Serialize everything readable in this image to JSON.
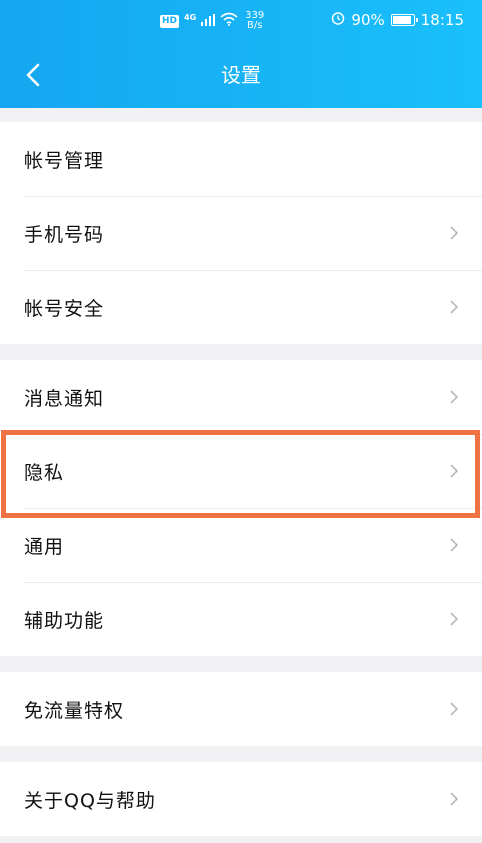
{
  "status_bar": {
    "hd_badge": "HD",
    "network": "4G",
    "speed_value": "339",
    "speed_unit": "B/s",
    "battery": "90%",
    "time": "18:15"
  },
  "header": {
    "title": "设置"
  },
  "groups": [
    {
      "items": [
        {
          "label": "帐号管理",
          "chevron": false
        },
        {
          "label": "手机号码",
          "chevron": true
        },
        {
          "label": "帐号安全",
          "chevron": true
        }
      ]
    },
    {
      "items": [
        {
          "label": "消息通知",
          "chevron": true
        },
        {
          "label": "隐私",
          "chevron": true
        },
        {
          "label": "通用",
          "chevron": true
        },
        {
          "label": "辅助功能",
          "chevron": true
        }
      ]
    },
    {
      "items": [
        {
          "label": "免流量特权",
          "chevron": true
        }
      ]
    },
    {
      "items": [
        {
          "label": "关于QQ与帮助",
          "chevron": true
        }
      ]
    }
  ],
  "colors": {
    "header": "#19b2f5",
    "highlight": "#ef7242",
    "background": "#f1f1f4"
  }
}
